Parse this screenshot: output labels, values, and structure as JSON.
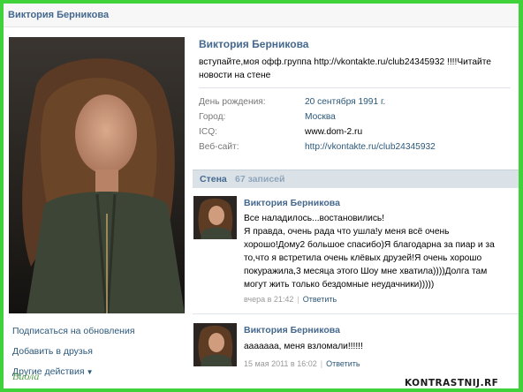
{
  "window": {
    "title": "Виктория Берникова"
  },
  "left": {
    "links": {
      "subscribe": "Подписаться на обновления",
      "add_friend": "Добавить в друзья",
      "other_actions": "Другие действия"
    },
    "watermark": "Виола"
  },
  "profile": {
    "name": "Виктория Берникова",
    "status_line1": "вступайте,моя офф.группа http://vkontakte.ru/club24345932 !!!!Читайте",
    "status_line2": "новости на стене",
    "info": [
      {
        "label": "День рождения:",
        "value": "20 сентября 1991 г."
      },
      {
        "label": "Город:",
        "value": "Москва"
      },
      {
        "label": "ICQ:",
        "value": "www.dom-2.ru"
      },
      {
        "label": "Веб-сайт:",
        "value": "http://vkontakte.ru/club24345932"
      }
    ]
  },
  "wall": {
    "label": "Стена",
    "count": "67 записей",
    "posts": [
      {
        "author": "Виктория Берникова",
        "lines": [
          "Все наладилось...востановились!",
          "Я правда, очень рада что ушла!у меня всё очень",
          "хорошо!Дому2 большое спасибо)Я благодарна за пиар и за",
          "то,что я встретила очень клёвых друзей!Я очень хорошо",
          "покуражила,3 месяца этого Шоу мне хватила))))Долга там",
          "могут жить только бездомные неудачники)))))"
        ],
        "time": "вчера в 21:42",
        "reply": "Ответить"
      },
      {
        "author": "Виктория Берникова",
        "lines": [
          "ааааааа, меня взломали!!!!!!"
        ],
        "time": "15 мая 2011 в 16:02",
        "reply": "Ответить"
      }
    ]
  },
  "watermark": "KONTRASTNIJ.RF",
  "colors": {
    "frame": "#3fd23a",
    "link": "#2b587a",
    "name": "#45688e",
    "wallbar": "#dae2e8"
  }
}
